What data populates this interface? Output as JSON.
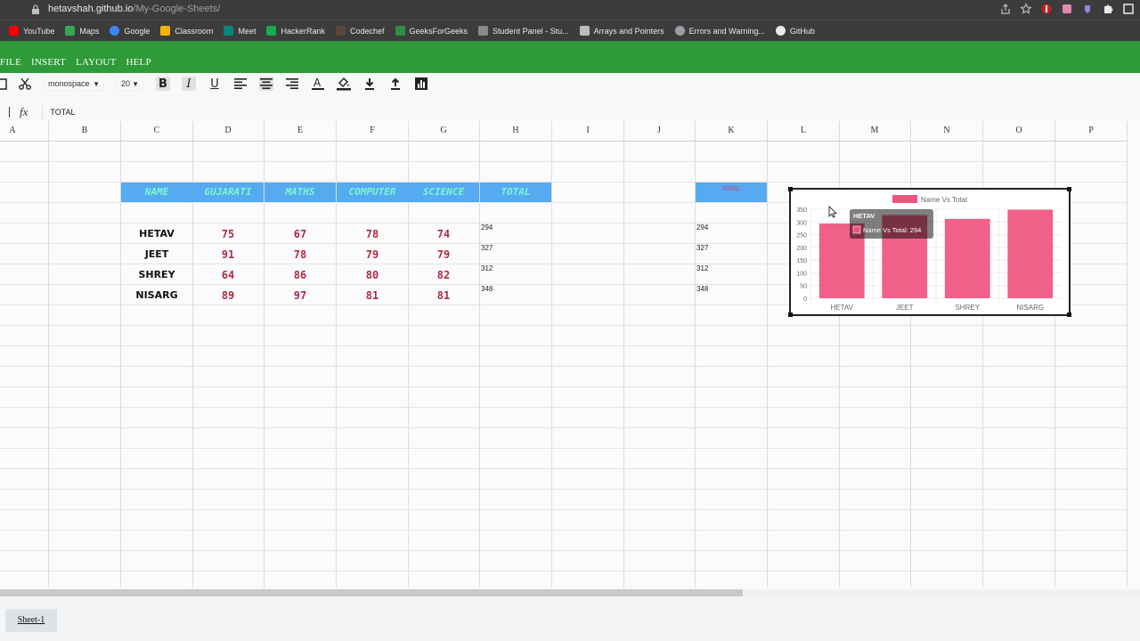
{
  "browser": {
    "url_host": "hetavshah.github.io",
    "url_path": "/My-Google-Sheets/",
    "bookmarks": [
      {
        "label": "YouTube",
        "icon": "youtube-icon",
        "color": "#ff0000"
      },
      {
        "label": "Maps",
        "icon": "maps-icon",
        "color": "#34a853"
      },
      {
        "label": "Google",
        "icon": "google-icon",
        "color": "#4285f4"
      },
      {
        "label": "Classroom",
        "icon": "classroom-icon",
        "color": "#f4b400"
      },
      {
        "label": "Meet",
        "icon": "meet-icon",
        "color": "#00897b"
      },
      {
        "label": "HackerRank",
        "icon": "hackerrank-icon",
        "color": "#1ba94c"
      },
      {
        "label": "Codechef",
        "icon": "codechef-icon",
        "color": "#5b4638"
      },
      {
        "label": "GeeksForGeeks",
        "icon": "gfg-icon",
        "color": "#2f8d46"
      },
      {
        "label": "Student Panel - Stu...",
        "icon": "student-panel-icon",
        "color": "#8a8a8a"
      },
      {
        "label": "Arrays and Pointers",
        "icon": "arrays-icon",
        "color": "#bbbbbb"
      },
      {
        "label": "Errors and Warning...",
        "icon": "errors-icon",
        "color": "#9aa0a6"
      },
      {
        "label": "GitHub",
        "icon": "github-icon",
        "color": "#ffffff"
      }
    ]
  },
  "menu": [
    "FILE",
    "INSERT",
    "LAYOUT",
    "HELP"
  ],
  "toolbar": {
    "font_family": "monospace",
    "font_size": "20"
  },
  "formula": {
    "fx_label": "fx",
    "value": "TOTAL"
  },
  "columns": [
    "A",
    "B",
    "C",
    "D",
    "E",
    "F",
    "G",
    "H",
    "I",
    "J",
    "K",
    "L",
    "M",
    "N",
    "O",
    "P"
  ],
  "table": {
    "headers": [
      "NAME",
      "GUJARATI",
      "MATHS",
      "COMPUTER",
      "SCIENCE",
      "TOTAL"
    ],
    "rows": [
      {
        "name": "HETAV",
        "gujarati": "75",
        "maths": "67",
        "computer": "78",
        "science": "74",
        "total": "294"
      },
      {
        "name": "JEET",
        "gujarati": "91",
        "maths": "78",
        "computer": "79",
        "science": "79",
        "total": "327"
      },
      {
        "name": "SHREY",
        "gujarati": "64",
        "maths": "86",
        "computer": "80",
        "science": "82",
        "total": "312"
      },
      {
        "name": "NISARG",
        "gujarati": "89",
        "maths": "97",
        "computer": "81",
        "science": "81",
        "total": "348"
      }
    ],
    "k_header": "TOTAL",
    "k_values": [
      "294",
      "327",
      "312",
      "348"
    ]
  },
  "sheet_tab": "Sheet-1",
  "colors": {
    "menubar": "#2e9a38",
    "header_fill": "#56aaf0",
    "header_text": "#7cf7d2",
    "score_text": "#b02a44",
    "bar": "#f0527f"
  },
  "chart_data": {
    "type": "bar",
    "categories": [
      "HETAV",
      "JEET",
      "SHREY",
      "NISARG"
    ],
    "series": [
      {
        "name": "Name Vs Total",
        "values": [
          294,
          327,
          312,
          348
        ]
      }
    ],
    "ylim": [
      0,
      350
    ],
    "yticks": [
      0,
      50,
      100,
      150,
      200,
      250,
      300,
      350
    ],
    "legend": "top",
    "grid": true,
    "tooltip": {
      "title": "HETAV",
      "label": "Name Vs Total: 294"
    }
  }
}
